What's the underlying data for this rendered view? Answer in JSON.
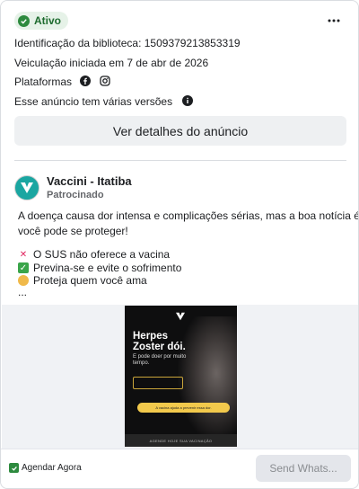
{
  "status": {
    "label": "Ativo",
    "icon": "check-circle-icon",
    "color": "#2d8a3e"
  },
  "more_menu": {
    "icon": "more-horizontal-icon"
  },
  "library_id": "Identificação da biblioteca: 1509379213853319",
  "run_started": "Veiculação iniciada em 7 de abr de 2026",
  "platforms": {
    "label": "Plataformas",
    "icons": [
      "facebook-icon",
      "instagram-icon"
    ]
  },
  "versions": {
    "label": "Esse anúncio tem várias versões",
    "icon": "info-icon"
  },
  "details_button": "Ver detalhes do anúncio",
  "advertiser": {
    "name": "Vaccini - Itatiba",
    "sponsored": "Patrocinado",
    "brand_color": "#1aa6a1"
  },
  "ad_body": {
    "lines": [
      "A doença causa dor intensa e complicações sérias, mas a boa notícia é que",
      "você pode se proteger!"
    ],
    "bullets": [
      {
        "emoji": "cross-mark-icon",
        "text": "O SUS não oferece a vacina"
      },
      {
        "emoji": "check-mark-button-icon",
        "text": "Previna-se e evite o sofrimento"
      },
      {
        "emoji": "people-hugging-icon",
        "text": "Proteja quem você ama"
      }
    ],
    "ellipsis": "..."
  },
  "creative": {
    "title_line1": "Herpes",
    "title_line2": "Zoster dói.",
    "subtitle": "E pode doer por muito tempo.",
    "cta": "A vacina ajuda a prevenir essa dor.",
    "footer": "AGENDE HOJE SUA VACINAÇÃO",
    "accent": "#f2c94c"
  },
  "footer": {
    "cta_label": "Agendar Agora",
    "send_button": "Send Whats..."
  }
}
